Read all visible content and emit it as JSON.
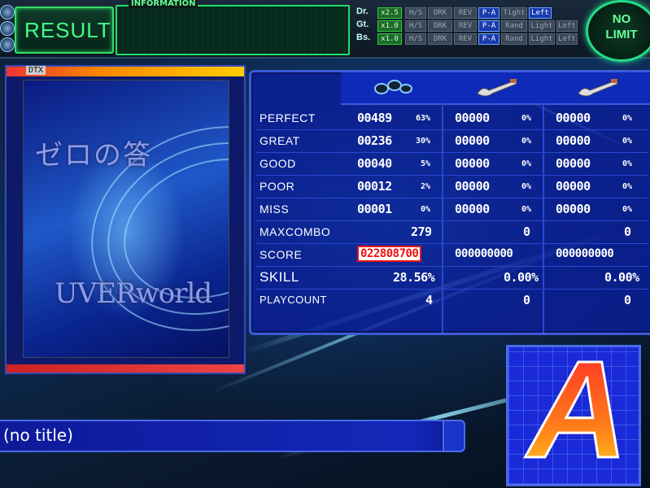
{
  "header": {
    "result_label": "RESULT",
    "information_label": "INFORMATION",
    "nolimit_line1": "NO",
    "nolimit_line2": "LIMIT"
  },
  "options": [
    {
      "part": "Dr.",
      "chips": [
        "x2.5",
        "H/S",
        "DRK",
        "REV",
        "P-A",
        "Tight",
        "Left"
      ]
    },
    {
      "part": "Gt.",
      "chips": [
        "x1.0",
        "H/S",
        "DRK",
        "REV",
        "P-A",
        "Rand",
        "Light",
        "Left"
      ]
    },
    {
      "part": "Bs.",
      "chips": [
        "x1.0",
        "H/S",
        "DRK",
        "REV",
        "P-A",
        "Rand",
        "Light",
        "Left"
      ]
    }
  ],
  "jacket": {
    "strip_label": "DTX",
    "title_text": "ゼロの答",
    "artist_text": "UVERworld"
  },
  "score_table": {
    "labels": [
      "PERFECT",
      "GREAT",
      "GOOD",
      "POOR",
      "MISS",
      "MAXCOMBO",
      "SCORE",
      "SKILL",
      "PLAYCOUNT"
    ],
    "drums": {
      "counts": [
        "00489",
        "00236",
        "00040",
        "00012",
        "00001"
      ],
      "pcts": [
        "63%",
        "30%",
        "5%",
        "2%",
        "0%"
      ],
      "maxcombo": "279",
      "score": "022808700",
      "skill": "28.56%",
      "playcount": "4"
    },
    "guitar": {
      "counts": [
        "00000",
        "00000",
        "00000",
        "00000",
        "00000"
      ],
      "pcts": [
        "0%",
        "0%",
        "0%",
        "0%",
        "0%"
      ],
      "maxcombo": "0",
      "score": "000000000",
      "skill": "0.00%",
      "playcount": "0"
    },
    "bass": {
      "counts": [
        "00000",
        "00000",
        "00000",
        "00000",
        "00000"
      ],
      "pcts": [
        "0%",
        "0%",
        "0%",
        "0%",
        "0%"
      ],
      "maxcombo": "0",
      "score": "000000000",
      "skill": "0.00%",
      "playcount": "0"
    }
  },
  "song_title": "(no title)",
  "rank": "A"
}
